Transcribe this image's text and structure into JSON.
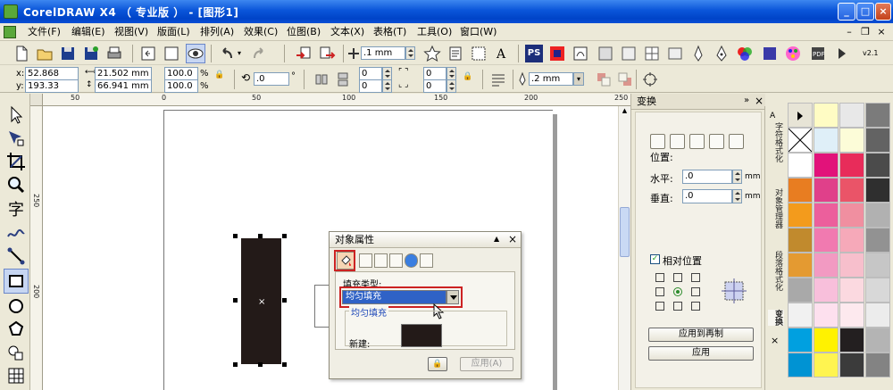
{
  "window": {
    "title": "CorelDRAW X4 （ 专业版 ） - [图形1]"
  },
  "menus": [
    {
      "label": "文件(F)"
    },
    {
      "label": "编辑(E)"
    },
    {
      "label": "视图(V)"
    },
    {
      "label": "版面(L)"
    },
    {
      "label": "排列(A)"
    },
    {
      "label": "效果(C)"
    },
    {
      "label": "位图(B)"
    },
    {
      "label": "文本(X)"
    },
    {
      "label": "表格(T)"
    },
    {
      "label": "工具(O)"
    },
    {
      "label": "窗口(W)"
    }
  ],
  "toolbar": {
    "nudge_value": ".1 mm",
    "ps_label": "PS"
  },
  "propertybar": {
    "x_label": "x:",
    "x_value": "52.868 mm",
    "y_label": "y:",
    "y_value": "193.33 mm",
    "w_value": "21.502 mm",
    "h_value": "66.941 mm",
    "scale_w": "100.0",
    "scale_h": "100.0",
    "pct": "%",
    "angle": ".0",
    "corner_a": "0",
    "corner_b": "0",
    "corner_c": "0",
    "corner_d": "0",
    "outline_width": ".2 mm"
  },
  "ruler_h": [
    "50",
    "0",
    "50",
    "100",
    "150",
    "200",
    "250"
  ],
  "ruler_v": [
    "250",
    "200"
  ],
  "dialog": {
    "title": "对象属性",
    "fill_type_label": "填充类型:",
    "fill_type_value": "均匀填充",
    "group_label": "均匀填充",
    "new_label": "新建:",
    "apply_label": "应用(A)"
  },
  "docker": {
    "title": "变换",
    "position_label": "位置:",
    "horizontal_label": "水平:",
    "horizontal_value": ".0",
    "vertical_label": "垂直:",
    "vertical_value": ".0",
    "unit": "mm",
    "relative_label": "相对位置",
    "apply_dup_label": "应用到再制",
    "apply_label": "应用"
  },
  "side_tabs": [
    "字符格式化",
    "对象管理器",
    "段落格式化",
    "变换"
  ],
  "colors": {
    "accent": "#0a55d9",
    "selection": "#2f62c6",
    "highlight_box": "#cc2222",
    "rect_fill": "#231a18"
  },
  "palette": [
    [
      "#c7e4f5",
      "#fffcc4",
      "#e8e8e8",
      "#7b7b7b"
    ],
    [
      "#ffffff",
      "#dfeff8",
      "#fcfcd8",
      "#636363"
    ],
    [
      "#ffffff",
      "#e2127a",
      "#e82c5a",
      "#4b4b4b"
    ],
    [
      "#e87d21",
      "#e0408a",
      "#ea5468",
      "#2f2f2f"
    ],
    [
      "#f39b1c",
      "#ec5f9c",
      "#f08fa0",
      "#b1b1b1"
    ],
    [
      "#c18a2d",
      "#f17ab0",
      "#f6a9b9",
      "#929292"
    ],
    [
      "#e49a31",
      "#f29ac2",
      "#f7bfcc",
      "#c6c6c6"
    ],
    [
      "#a9a9a9",
      "#f8bfdb",
      "#fbd9e0",
      "#d8d8d8"
    ],
    [
      "#f1f1f1",
      "#fde0ee",
      "#fde9ee",
      "#ececec"
    ],
    [
      "#00a0e0",
      "#fff200",
      "#231f20",
      "#b4b4b4"
    ],
    [
      "#0093d3",
      "#fff450",
      "#3b3b3b",
      "#838383"
    ]
  ]
}
